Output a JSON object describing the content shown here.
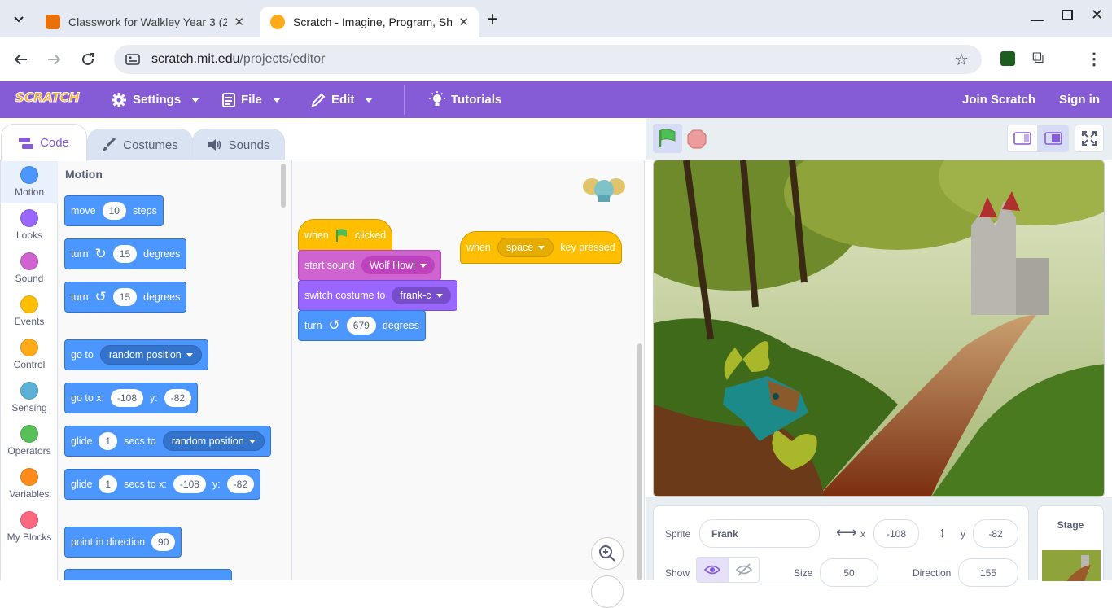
{
  "browser": {
    "tabs": [
      {
        "title": "Classwork for Walkley Year 3 (2",
        "active": false
      },
      {
        "title": "Scratch - Imagine, Program, Sha",
        "active": true
      }
    ],
    "url_host": "scratch.mit.edu",
    "url_path": "/projects/editor"
  },
  "menubar": {
    "logo": "SCRATCH",
    "settings": "Settings",
    "file": "File",
    "edit": "Edit",
    "tutorials": "Tutorials",
    "join": "Join Scratch",
    "signin": "Sign in"
  },
  "editor_tabs": {
    "code": "Code",
    "costumes": "Costumes",
    "sounds": "Sounds"
  },
  "categories": [
    {
      "label": "Motion",
      "color": "#4c97ff"
    },
    {
      "label": "Looks",
      "color": "#9966ff"
    },
    {
      "label": "Sound",
      "color": "#cf63cf"
    },
    {
      "label": "Events",
      "color": "#ffbf00"
    },
    {
      "label": "Control",
      "color": "#ffab19"
    },
    {
      "label": "Sensing",
      "color": "#5cb1d6"
    },
    {
      "label": "Operators",
      "color": "#59c059"
    },
    {
      "label": "Variables",
      "color": "#ff8c1a"
    },
    {
      "label": "My Blocks",
      "color": "#ff6680"
    }
  ],
  "palette": {
    "heading": "Motion",
    "move": {
      "a": "move",
      "n": "10",
      "b": "steps"
    },
    "turn_right": {
      "a": "turn",
      "n": "15",
      "b": "degrees"
    },
    "turn_left": {
      "a": "turn",
      "n": "15",
      "b": "degrees"
    },
    "goto": {
      "a": "go to",
      "dd": "random position"
    },
    "gotoxy": {
      "a": "go to x:",
      "x": "-108",
      "b": "y:",
      "y": "-82"
    },
    "glide_to": {
      "a": "glide",
      "n": "1",
      "b": "secs to",
      "dd": "random position"
    },
    "glide_xy": {
      "a": "glide",
      "n": "1",
      "b": "secs to x:",
      "x": "-108",
      "c": "y:",
      "y": "-82"
    },
    "point": {
      "a": "point in direction",
      "n": "90"
    }
  },
  "script1": {
    "hat": {
      "a": "when",
      "b": "clicked"
    },
    "sound": {
      "a": "start sound",
      "dd": "Wolf Howl"
    },
    "costume": {
      "a": "switch costume to",
      "dd": "frank-c"
    },
    "turn": {
      "a": "turn",
      "n": "679",
      "b": "degrees"
    }
  },
  "script2": {
    "a": "when",
    "dd": "space",
    "b": "key pressed"
  },
  "sprite_info": {
    "sprite_label": "Sprite",
    "sprite_name": "Frank",
    "x_label": "x",
    "x": "-108",
    "y_label": "y",
    "y": "-82",
    "show_label": "Show",
    "size_label": "Size",
    "size": "50",
    "direction_label": "Direction",
    "direction": "155"
  },
  "stage_panel": {
    "label": "Stage"
  },
  "colors": {
    "scratch_purple": "#855cd6",
    "motion": "#4c97ff",
    "events": "#ffbf00"
  }
}
